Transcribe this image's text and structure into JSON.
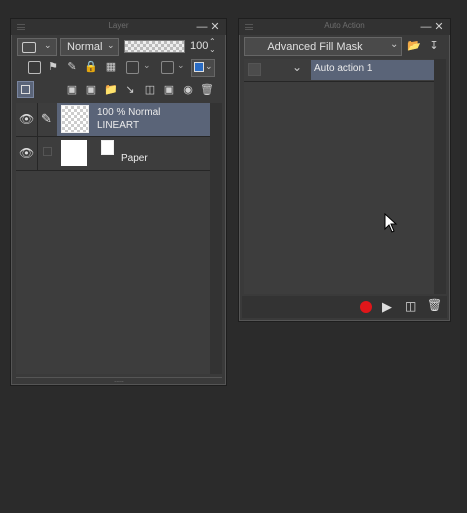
{
  "layer_panel": {
    "title": "Layer",
    "blend_mode": "Normal",
    "opacity": "100",
    "opacity_fraction": 1.0,
    "layers": [
      {
        "opacity_mode": "100 % Normal",
        "name": "LINEART",
        "selected": true
      },
      {
        "name": "Paper",
        "selected": false
      }
    ],
    "resize_grip": "....."
  },
  "auto_action_panel": {
    "title": "Auto Action",
    "set_name": "Advanced Fill Mask",
    "actions": [
      {
        "name": "Auto action 1"
      }
    ]
  },
  "colors": {
    "background": "#2b2b2b",
    "panel": "#3a3a3a",
    "selected_row": "#5a6478",
    "accent_blue": "#2a6cc4",
    "record_red": "#e0161a"
  },
  "icons": {
    "close": "close-icon",
    "minimize": "minimize-icon",
    "eye": "eye-icon",
    "pen": "pen-icon",
    "record": "record-icon",
    "play": "play-icon",
    "trash": "trash-icon"
  }
}
